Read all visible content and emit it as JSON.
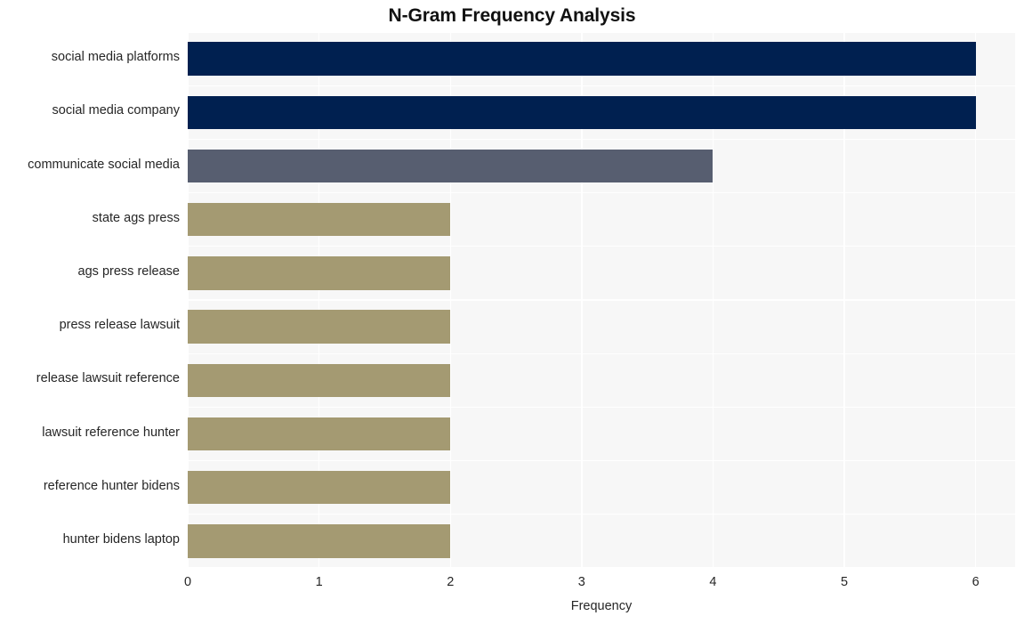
{
  "chart_data": {
    "type": "bar",
    "orientation": "horizontal",
    "title": "N-Gram Frequency Analysis",
    "xlabel": "Frequency",
    "ylabel": "",
    "categories": [
      "social media platforms",
      "social media company",
      "communicate social media",
      "state ags press",
      "ags press release",
      "press release lawsuit",
      "release lawsuit reference",
      "lawsuit reference hunter",
      "reference hunter bidens",
      "hunter bidens laptop"
    ],
    "values": [
      6,
      6,
      4,
      2,
      2,
      2,
      2,
      2,
      2,
      2
    ],
    "bar_colors": [
      "#002050",
      "#002050",
      "#575e70",
      "#a49a72",
      "#a49a72",
      "#a49a72",
      "#a49a72",
      "#a49a72",
      "#a49a72",
      "#a49a72"
    ],
    "xlim": [
      0,
      6.3
    ],
    "xticks": [
      0,
      1,
      2,
      3,
      4,
      5,
      6
    ],
    "xtick_labels": [
      "0",
      "1",
      "2",
      "3",
      "4",
      "5",
      "6"
    ],
    "grid": true,
    "grid_color": "#ffffff",
    "plot_background": "#f7f7f7",
    "figure_background": "#ffffff",
    "legend": null
  }
}
